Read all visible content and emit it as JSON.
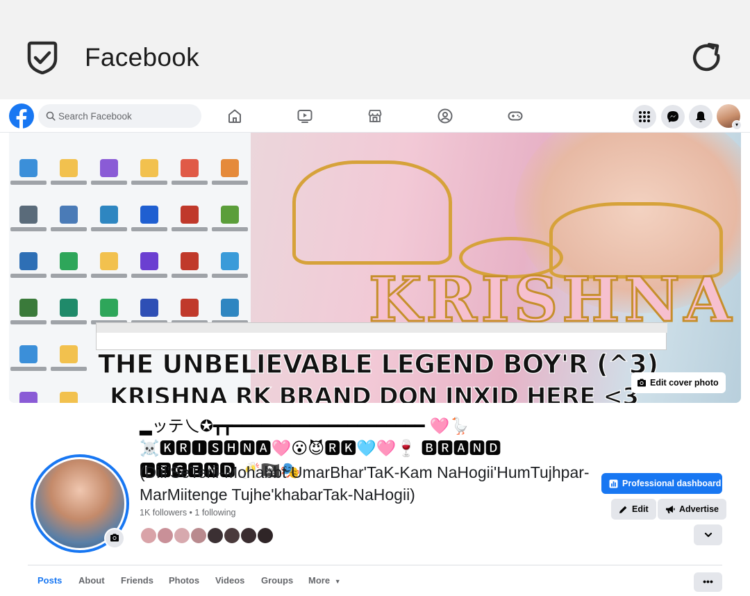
{
  "app": {
    "title": "Facebook"
  },
  "nav": {
    "search_placeholder": "Search Facebook",
    "icons": [
      "home-icon",
      "watch-icon",
      "marketplace-icon",
      "groups-icon",
      "gaming-icon"
    ],
    "right_icons": [
      "menu-grid-icon",
      "messenger-icon",
      "notifications-icon"
    ]
  },
  "cover": {
    "overlay_line1": "THE UNBELIEVABLE LEGEND BOY'R (^3)",
    "overlay_line2": "KRISHNA RK BRAND DON INXID HERE <3",
    "art_text": "KRISHNA",
    "edit_label": "Edit cover photo"
  },
  "profile": {
    "name": "▂ッテ乀✪┳┳━━━━━━━━━━━━━━━━━━━━ 🩷🪿☠️🅺🆁🅸🆂🅷🅽🅰🩷😮😈🆁🅺🩵🩷🍷 🅱🆁🅰🅽🅳 🅻🅴🅶🅴🅽🅳 🥂🏴‍☠️🎭",
    "bio": "(Diil'SeTerii-Mohabbt UmarBhar'TaK-Kam NaHogii'HumTujhpar-MarMiitenge Tujhe'khabarTak-NaHogii)",
    "followers": "1K followers • 1 following"
  },
  "buttons": {
    "pro_dashboard": "Professional dashboard",
    "edit": "Edit",
    "advertise": "Advertise",
    "chevron": "⌄"
  },
  "tabs": {
    "posts": "Posts",
    "about": "About",
    "friends": "Friends",
    "photos": "Photos",
    "videos": "Videos",
    "groups": "Groups",
    "more": "More",
    "more_menu": "•••"
  },
  "colors": {
    "brand": "#1877f2",
    "chrome": "#f2f2f2",
    "button_grey": "#e4e6eb"
  }
}
